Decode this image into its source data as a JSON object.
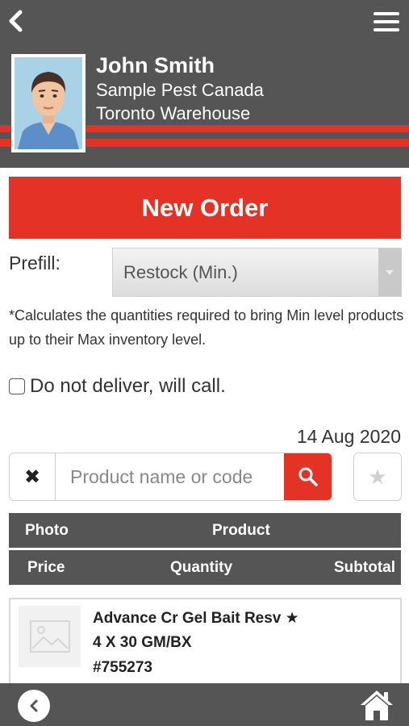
{
  "header": {
    "user_name": "John Smith",
    "company": "Sample Pest Canada",
    "location": "Toronto Warehouse"
  },
  "actions": {
    "new_order": "New Order"
  },
  "prefill": {
    "label": "Prefill:",
    "selected": "Restock (Min.)",
    "note": "*Calculates the quantities required to bring Min level products up to their Max inventory level."
  },
  "delivery": {
    "label": "Do not deliver, will call.",
    "checked": false
  },
  "order_date": "14 Aug 2020",
  "search": {
    "clear_icon": "✖",
    "placeholder": "Product name or code",
    "favorite_icon": "★"
  },
  "table": {
    "header_row1": {
      "photo": "Photo",
      "product": "Product"
    },
    "header_row2": {
      "price": "Price",
      "quantity": "Quantity",
      "subtotal": "Subtotal"
    }
  },
  "products": [
    {
      "name": "Advance Cr Gel Bait Resv ★",
      "size": "4 X 30 GM/BX",
      "code": "#755273"
    }
  ],
  "colors": {
    "accent": "#e53226",
    "header_bg": "#555555",
    "avatar_bg": "#a9d2e6"
  }
}
